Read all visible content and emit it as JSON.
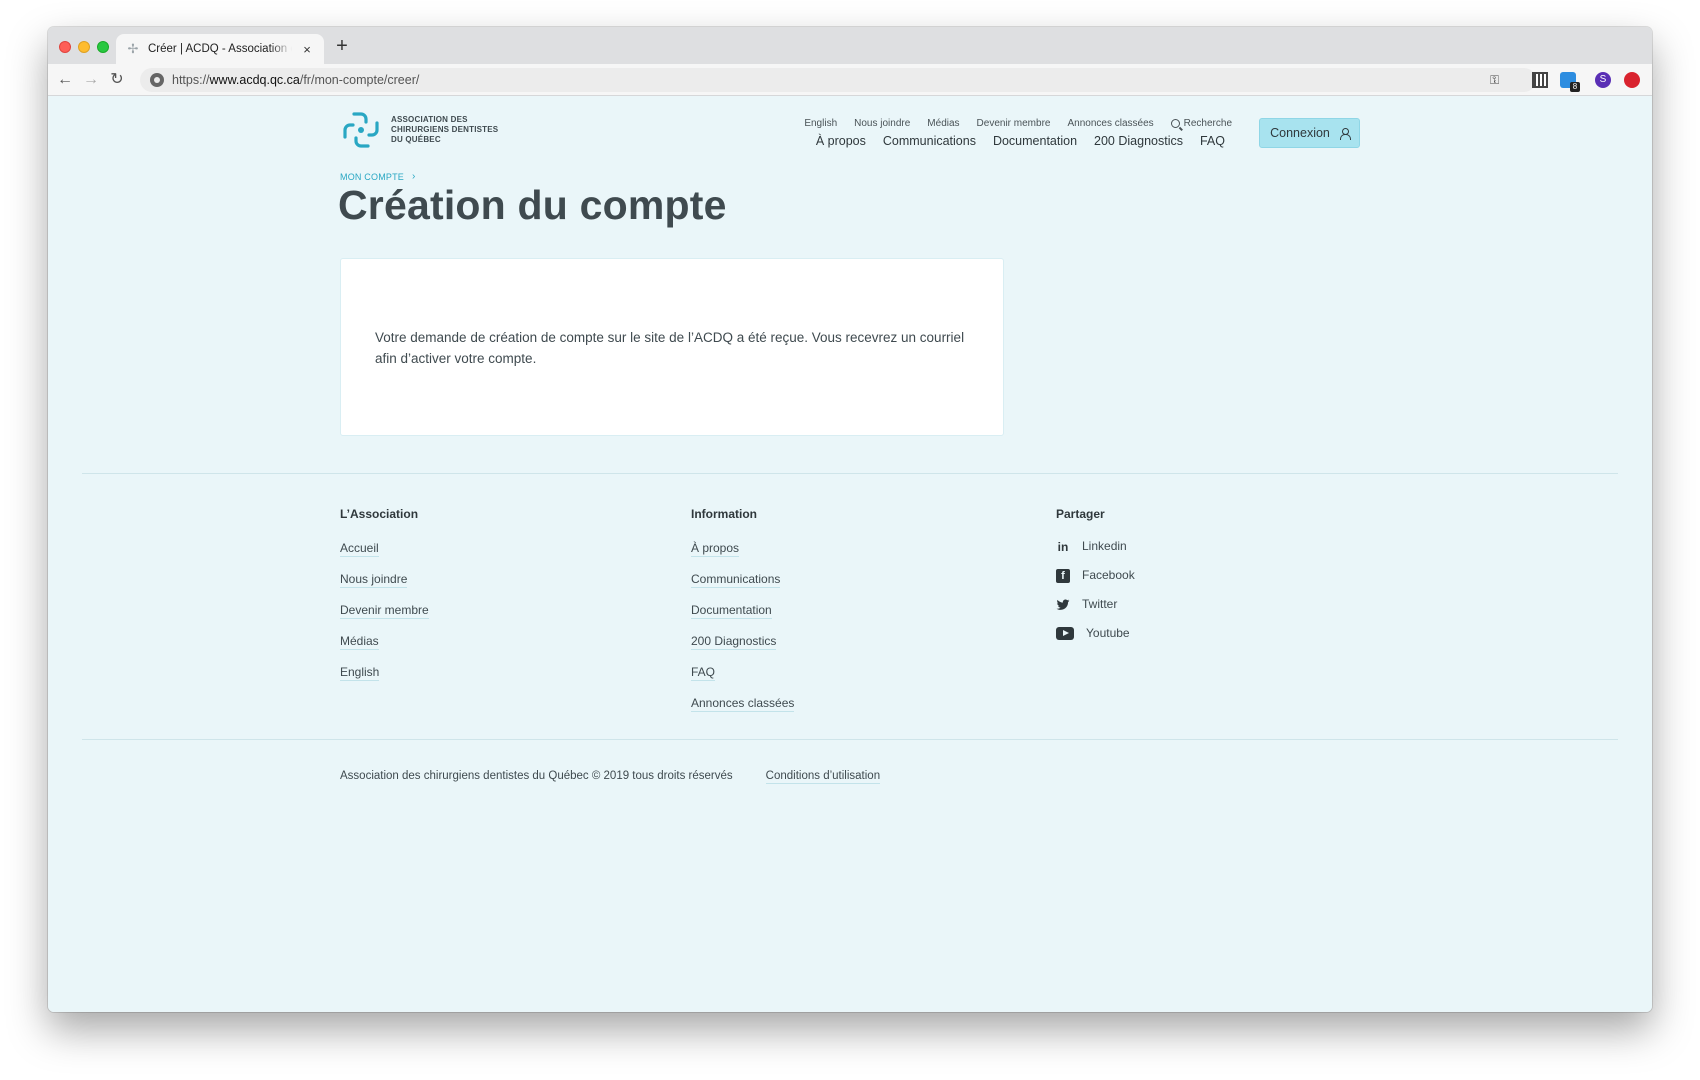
{
  "browser": {
    "tab_title": "Créer | ACDQ - Association des chirurgiens dentistes du Québec",
    "new_tab": "+",
    "tab_close": "×",
    "url_scheme": "https://",
    "url_host": "www.acdq.qc.ca",
    "url_path": "/fr/mon-compte/creer/",
    "extension_badge": "8",
    "profile_initial": "S"
  },
  "header": {
    "logo_lines": [
      "ASSOCIATION DES",
      "CHIRURGIENS DENTISTES",
      "DU QUÉBEC"
    ],
    "small_nav": [
      "English",
      "Nous joindre",
      "Médias",
      "Devenir membre",
      "Annonces classées"
    ],
    "search_label": "Recherche",
    "main_nav": [
      "À propos",
      "Communications",
      "Documentation",
      "200 Diagnostics",
      "FAQ"
    ],
    "login_label": "Connexion"
  },
  "breadcrumb": {
    "item": "MON COMPTE",
    "separator": "›"
  },
  "main": {
    "title": "Création du compte",
    "message": "Votre demande de création de compte sur le site de l’ACDQ a été reçue. Vous recevrez un courriel afin d’activer votre compte."
  },
  "footer": {
    "association": {
      "heading": "L’Association",
      "links": [
        "Accueil",
        "Nous joindre",
        "Devenir membre",
        "Médias",
        "English"
      ]
    },
    "information": {
      "heading": "Information",
      "links": [
        "À propos",
        "Communications",
        "Documentation",
        "200 Diagnostics",
        "FAQ",
        "Annonces classées"
      ]
    },
    "share": {
      "heading": "Partager",
      "links": [
        {
          "label": "Linkedin",
          "icon": "linkedin-icon"
        },
        {
          "label": "Facebook",
          "icon": "facebook-icon"
        },
        {
          "label": "Twitter",
          "icon": "twitter-icon"
        },
        {
          "label": "Youtube",
          "icon": "youtube-icon"
        }
      ]
    },
    "copyright": "Association des chirurgiens dentistes du Québec © 2019 tous droits réservés",
    "terms": "Conditions d’utilisation"
  },
  "colors": {
    "page_background": "#eaf6f9",
    "accent": "#29a7c3",
    "login_button": "#a8e3ef",
    "text": "#3f4a4f"
  }
}
